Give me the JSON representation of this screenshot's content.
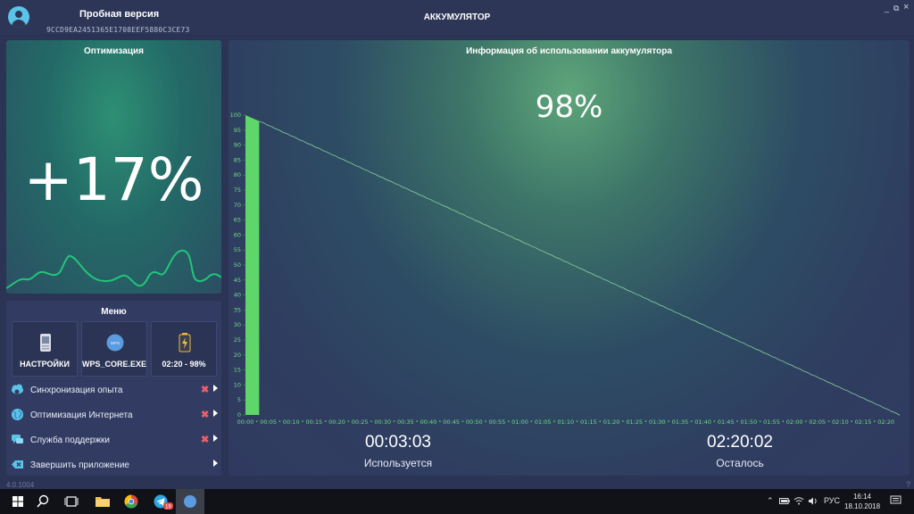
{
  "header": {
    "app_name": "Пробная версия",
    "device_id": "9CCD9EA2451365E1708EEF5880C3CE73",
    "window_title": "АККУМУЛЯТОР",
    "minimize": "_",
    "restore": "⧉",
    "close": "×"
  },
  "optimization": {
    "title": "Оптимизация",
    "value": "+17%"
  },
  "menu": {
    "title": "Меню",
    "tiles": [
      {
        "label": "НАСТРОЙКИ",
        "icon": "settings-device-icon"
      },
      {
        "label": "WPS_CORE.EXE",
        "icon": "wps-icon",
        "icon_text": "WPS"
      },
      {
        "label": "02:20 - 98%",
        "icon": "battery-icon"
      }
    ],
    "items": [
      {
        "label": "Синхронизация опыта",
        "icon": "cloud-sync-icon",
        "mark": "✖"
      },
      {
        "label": "Оптимизация Интернета",
        "icon": "globe-icon",
        "mark": "✖"
      },
      {
        "label": "Служба поддержки",
        "icon": "chat-icon",
        "mark": "✖"
      },
      {
        "label": "Завершить приложение",
        "icon": "exit-icon"
      }
    ]
  },
  "battery_info": {
    "title": "Информация об использовании аккумулятора",
    "percent": "98%",
    "used_time": "00:03:03",
    "used_label": "Используется",
    "remaining_time": "02:20:02",
    "remaining_label": "Осталось"
  },
  "chart_data": {
    "type": "area",
    "y_ticks": [
      "0",
      "5",
      "10",
      "15",
      "20",
      "25",
      "30",
      "35",
      "40",
      "45",
      "50",
      "55",
      "60",
      "65",
      "70",
      "75",
      "80",
      "85",
      "90",
      "95",
      "100"
    ],
    "ylim": [
      0,
      100
    ],
    "x_ticks": [
      "00:00",
      "00:05",
      "00:10",
      "00:15",
      "00:20",
      "00:25",
      "00:30",
      "00:35",
      "00:40",
      "00:45",
      "00:50",
      "00:55",
      "01:00",
      "01:05",
      "01:10",
      "01:15",
      "01:20",
      "01:25",
      "01:30",
      "01:35",
      "01:40",
      "01:45",
      "01:50",
      "01:55",
      "02:00",
      "02:05",
      "02:10",
      "02:15",
      "02:20"
    ],
    "series": [
      {
        "kind": "used",
        "x": [
          "00:00",
          "00:03"
        ],
        "y": [
          100,
          98
        ],
        "color": "#5fd66a"
      },
      {
        "kind": "projection",
        "x": [
          "00:03",
          "02:23"
        ],
        "y": [
          98,
          0
        ],
        "color": "#8fd6a0"
      }
    ]
  },
  "footer": {
    "version": "4.0.1004",
    "help": "?"
  },
  "taskbar": {
    "tray_lang": "РУС",
    "time": "16:14",
    "date": "18.10.2018",
    "telegram_badge": "19"
  }
}
